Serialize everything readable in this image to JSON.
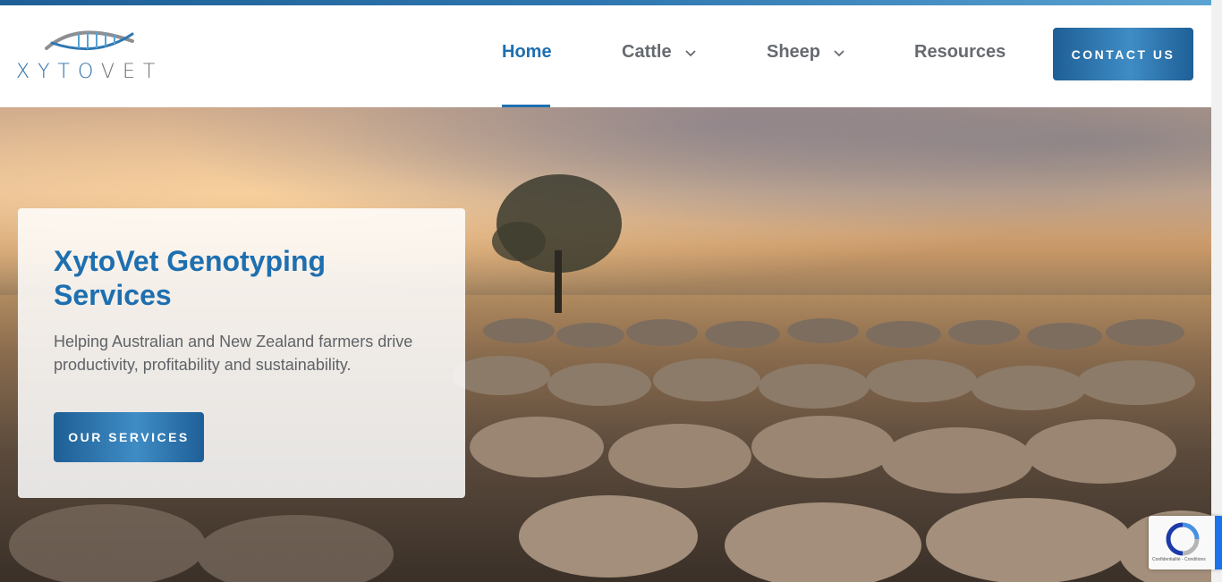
{
  "brand": {
    "logo_xyto": "XYTO",
    "logo_vet": "VET",
    "logo_icon": "dna-helix-icon",
    "accent_color": "#1e6fb0"
  },
  "nav": {
    "items": [
      {
        "label": "Home",
        "active": true,
        "dropdown": false
      },
      {
        "label": "Cattle",
        "active": false,
        "dropdown": true
      },
      {
        "label": "Sheep",
        "active": false,
        "dropdown": true
      },
      {
        "label": "Resources",
        "active": false,
        "dropdown": false
      }
    ],
    "contact_label": "CONTACT US"
  },
  "hero": {
    "title": "XytoVet Genotyping Services",
    "subtitle": "Helping Australian and New Zealand farmers drive productivity, profitability and sustainability.",
    "cta_label": "OUR SERVICES",
    "background": "sheep-flock-at-sunset-photo"
  },
  "recaptcha": {
    "footer": "Confidentialité - Conditions",
    "icon": "recaptcha-icon"
  }
}
